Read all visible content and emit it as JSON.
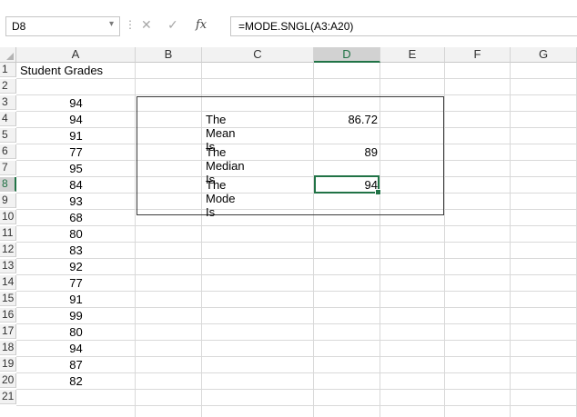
{
  "formula_bar": {
    "name_box": "D8",
    "name_box_dropdown": "▾",
    "cancel_glyph": "✕",
    "enter_glyph": "✓",
    "fx_glyph": "fx",
    "formula": "=MODE.SNGL(A3:A20)"
  },
  "columns": [
    "A",
    "B",
    "C",
    "D",
    "E",
    "F",
    "G"
  ],
  "rows": [
    "1",
    "2",
    "3",
    "4",
    "5",
    "6",
    "7",
    "8",
    "9",
    "10",
    "11",
    "12",
    "13",
    "14",
    "15",
    "16",
    "17",
    "18",
    "19",
    "20",
    "21"
  ],
  "sheet": {
    "header": "Student Grades",
    "grades": [
      "94",
      "94",
      "91",
      "77",
      "95",
      "84",
      "93",
      "68",
      "80",
      "83",
      "92",
      "77",
      "91",
      "99",
      "80",
      "94",
      "87",
      "82"
    ],
    "mean_label": "The Mean Is",
    "mean_value": "86.72",
    "median_label": "The Median Is",
    "median_value": "89",
    "mode_label": "The Mode Is",
    "mode_value": "94"
  },
  "colors": {
    "accent": "#217346"
  }
}
